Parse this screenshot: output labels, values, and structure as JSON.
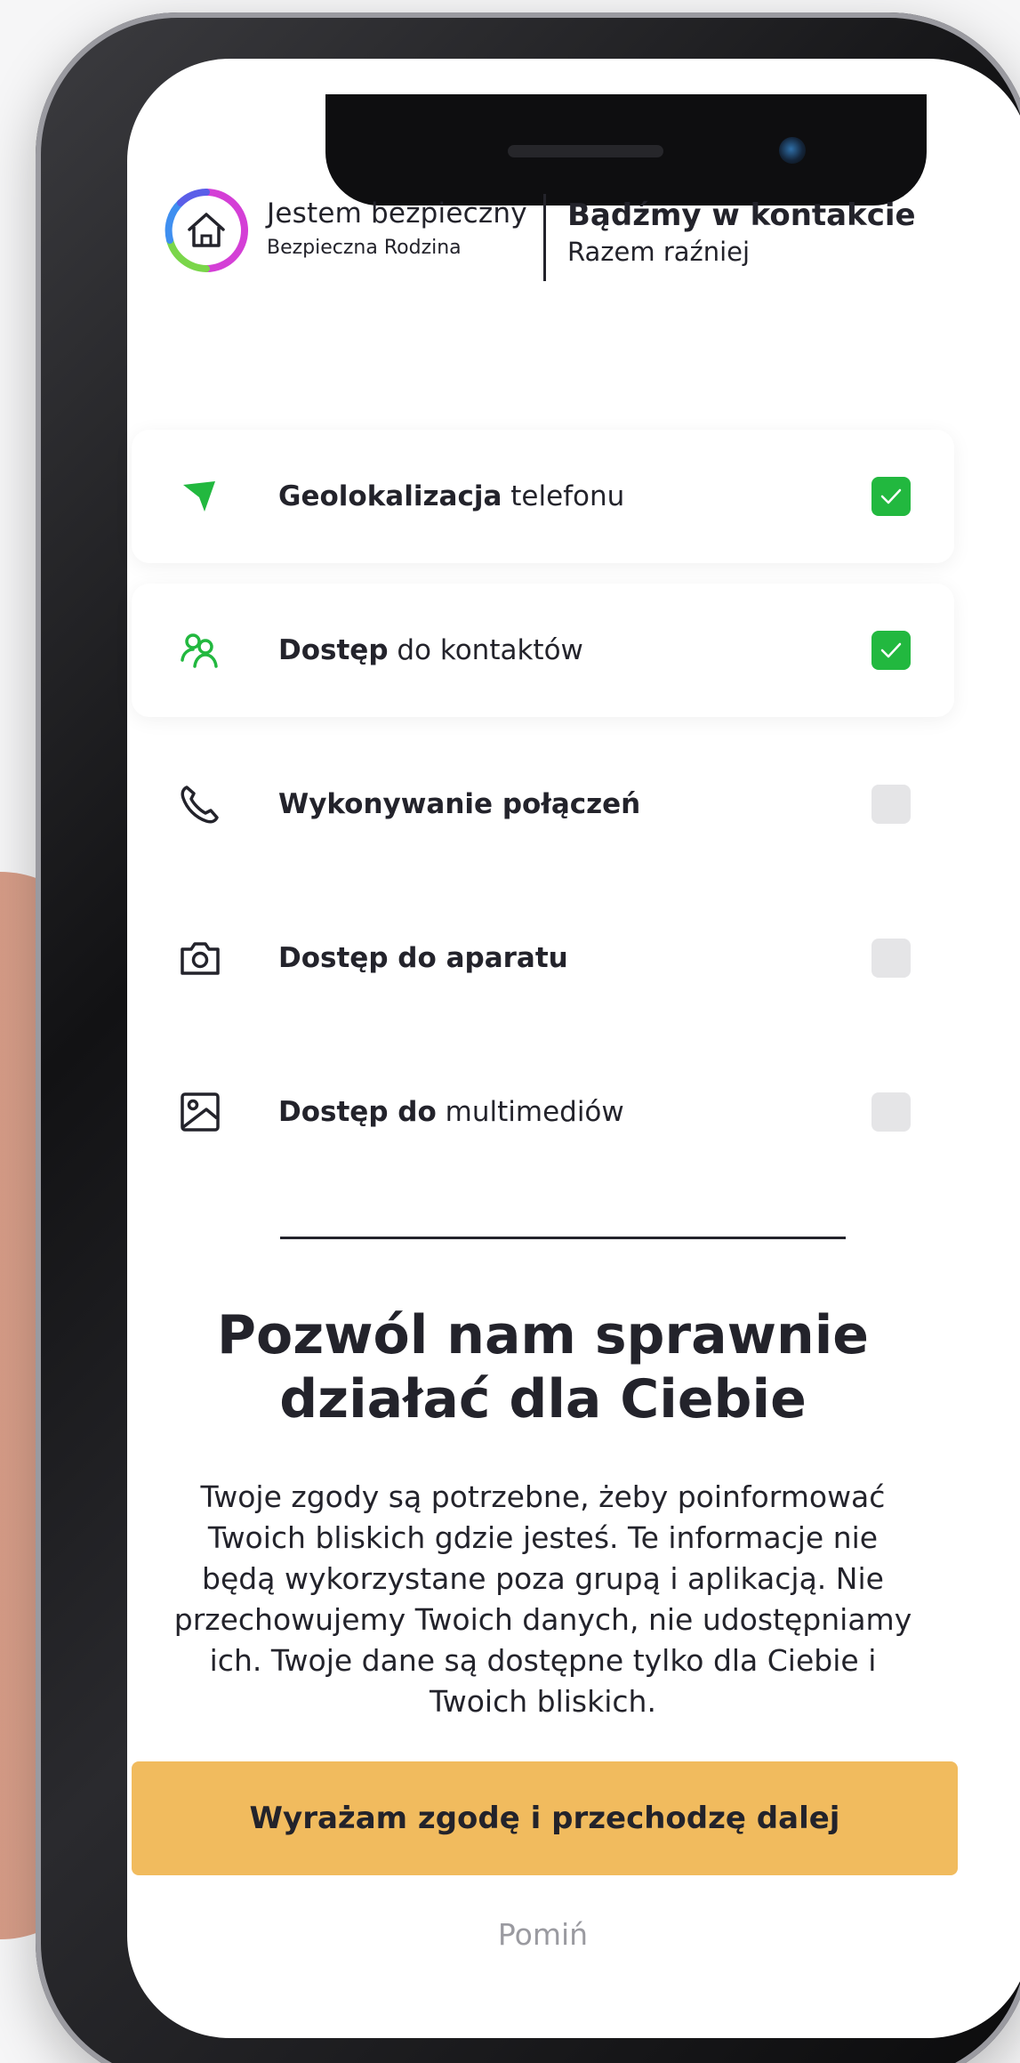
{
  "header": {
    "brand_title": "Jestem bezpieczny",
    "brand_subtitle": "Bezpieczna Rodzina",
    "tagline_title": "Bądźmy w kontakcie",
    "tagline_subtitle": "Razem raźniej"
  },
  "permissions": [
    {
      "bold": "Geolokalizacja",
      "rest": " telefonu",
      "checked": true,
      "icon": "location-arrow-icon"
    },
    {
      "bold": "Dostęp",
      "rest": " do kontaktów",
      "checked": true,
      "icon": "contacts-icon"
    },
    {
      "bold": "Wykonywanie połączeń",
      "rest": "",
      "checked": false,
      "icon": "phone-icon"
    },
    {
      "bold": "Dostęp do aparatu",
      "rest": "",
      "checked": false,
      "icon": "camera-icon"
    },
    {
      "bold": "Dostęp do",
      "rest": " multimediów",
      "checked": false,
      "icon": "image-icon"
    }
  ],
  "headline": {
    "line1": "Pozwól nam sprawnie",
    "line2": "działać dla Ciebie"
  },
  "body_lines": [
    "Twoje zgody są potrzebne, żeby poinformować",
    "Twoich bliskich gdzie jesteś. Te informacje nie",
    "będą wykorzystane poza grupą i aplikacją. Nie",
    "przechowujemy Twoich danych, nie udostępniamy",
    "ich. Twoje dane są dostępne tylko dla Ciebie i",
    "Twoich bliskich."
  ],
  "cta_label": "Wyrażam zgodę i przechodzę dalej",
  "skip_label": "Pomiń",
  "colors": {
    "accent_green": "#22b83f",
    "cta_yellow": "#f1bb5e",
    "text_dark": "#23232b",
    "muted": "#9a9aa0"
  }
}
